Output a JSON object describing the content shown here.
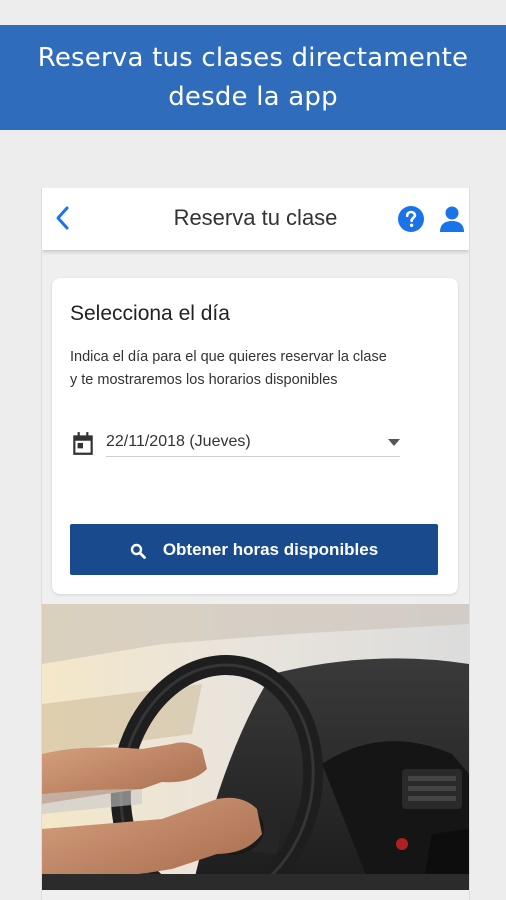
{
  "banner": {
    "text": "Reserva tus clases directamente\ndesde la app"
  },
  "appbar": {
    "title": "Reserva tu clase",
    "back_icon": "chevron-left-icon",
    "help_icon": "help-circle-icon",
    "user_icon": "user-icon",
    "accent_color": "#1a73e8"
  },
  "card": {
    "title": "Selecciona el día",
    "description": "Indica el día para el que quieres reservar la clase\ny te mostraremos los horarios disponibles",
    "date_icon": "calendar-icon",
    "date_value": "22/11/2018 (Jueves)",
    "search_button": {
      "label": "Obtener horas disponibles",
      "icon": "search-icon",
      "color": "#1a4a8e"
    }
  },
  "photo": {
    "subject": "hands-on-steering-wheel"
  },
  "colors": {
    "banner": "#2f6dbc",
    "background": "#ededed"
  }
}
